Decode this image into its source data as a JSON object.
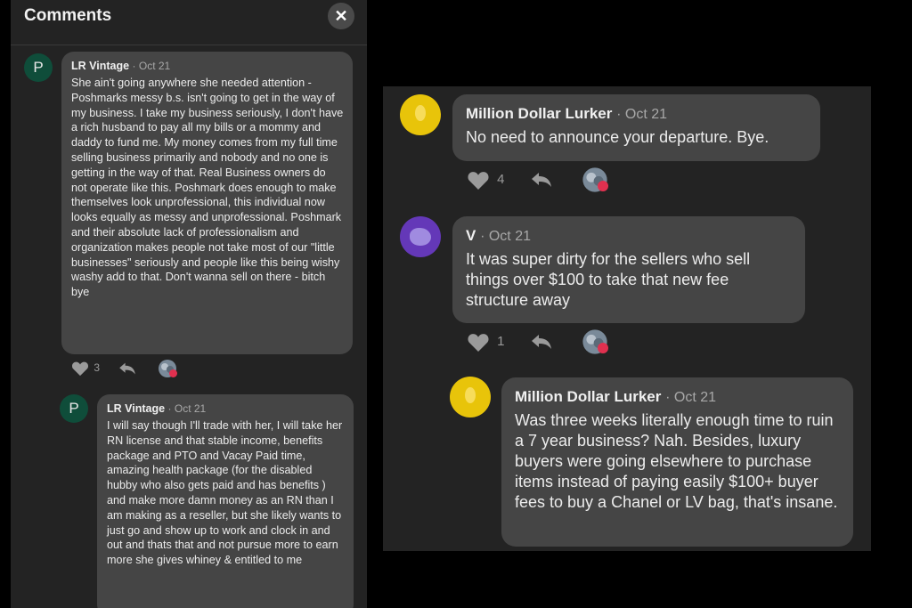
{
  "left": {
    "title": "Comments",
    "close_glyph": "✕",
    "comments": [
      {
        "avatar_letter": "P",
        "author": "LR Vintage",
        "date": "· Oct 21",
        "text": "She ain't going anywhere she needed attention - Poshmarks messy b.s. isn't going to get in the way of my business.  I take my business seriously, I don't have a rich husband to pay all my bills or a mommy and daddy to fund me.  My money comes from my full time selling business primarily and nobody and no one is getting in the way of that.  Real Business owners do not operate like this.  Poshmark does enough to make themselves look unprofessional, this individual now looks equally as messy and unprofessional.  Poshmark and their absolute lack of professionalism and organization makes people not take most of our \"little businesses\" seriously and people like this being wishy washy add to that.  Don't wanna sell on there - bitch bye",
        "likes": "3"
      },
      {
        "avatar_letter": "P",
        "author": "LR Vintage",
        "date": "· Oct 21",
        "text": "I will say though I'll trade with her, I will take her RN license and that stable income, benefits package and PTO and Vacay Paid time, amazing health package (for the disabled hubby who also gets paid and has benefits ) and make more damn money as an RN than I am making as a reseller, but she likely wants to just go and show up to work and clock in and out and thats that and not pursue more to earn more she gives whiney & entitled to me"
      }
    ]
  },
  "right": {
    "comments": [
      {
        "author": "Million Dollar Lurker",
        "date": "· Oct 21",
        "text": "No need to announce your departure. Bye.",
        "likes": "4"
      },
      {
        "author": "V",
        "date": "· Oct 21",
        "text": "It was super dirty for the sellers who sell things over $100 to take that new fee structure away",
        "likes": "1"
      },
      {
        "author": "Million Dollar Lurker",
        "date": "· Oct 21",
        "text": "Was three weeks literally enough time to ruin a 7 year business? Nah. Besides, luxury buyers were going elsewhere to purchase items instead of paying easily $100+ buyer fees to buy a Chanel or LV bag, that's insane."
      }
    ]
  },
  "colors": {
    "bubble": "#454545",
    "panel": "#232323",
    "heart_badge": "#e0304f",
    "avatar_green": "#0f4d3a",
    "avatar_yellow": "#e8c40a",
    "avatar_purple": "#6438b8"
  },
  "icons": [
    "close-icon",
    "heart-icon",
    "reply-icon",
    "reaction-avatar-icon"
  ]
}
